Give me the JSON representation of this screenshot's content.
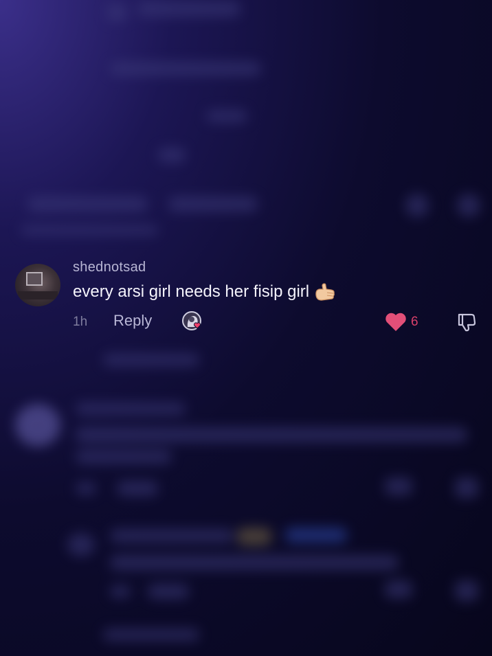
{
  "comment": {
    "username": "shednotsad",
    "text": "every arsi girl needs her fisip girl",
    "emoji": "call-me-hand-icon",
    "time": "1h",
    "reply_label": "Reply",
    "like_count": "6",
    "liked": true,
    "liked_by_creator": true
  },
  "colors": {
    "background": "#0d0b2e",
    "accent_like": "#d8406a",
    "text_primary": "#f4f3fb",
    "text_secondary": "#b8b6d4"
  },
  "icons": {
    "avatar": "user-avatar",
    "creator_like": "creator-liked-icon",
    "like": "heart-icon",
    "dislike": "thumbs-down-icon"
  }
}
